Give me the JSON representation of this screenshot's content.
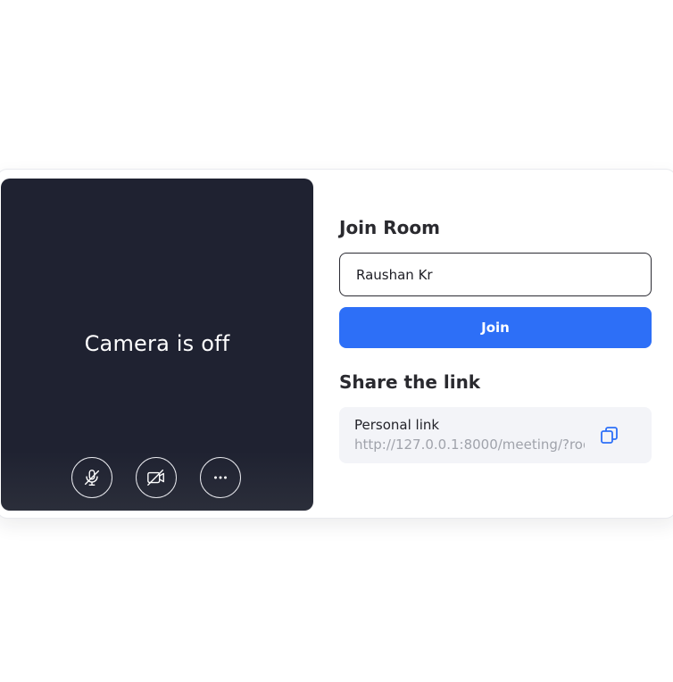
{
  "preview": {
    "camera_status": "Camera is off",
    "controls": [
      {
        "icon": "microphone-off-icon"
      },
      {
        "icon": "video-off-icon"
      },
      {
        "icon": "more-options-icon"
      }
    ]
  },
  "join": {
    "title": "Join Room",
    "name_value": "Raushan Kr",
    "button_label": "Join"
  },
  "share": {
    "title": "Share the link",
    "link_label": "Personal link",
    "link_url": "http://127.0.0.1:8000/meeting/?roo",
    "copy_icon": "copy-icon"
  },
  "colors": {
    "accent": "#2d6ff7",
    "preview_bg": "#1f2231",
    "link_bg": "#f3f4f8"
  }
}
